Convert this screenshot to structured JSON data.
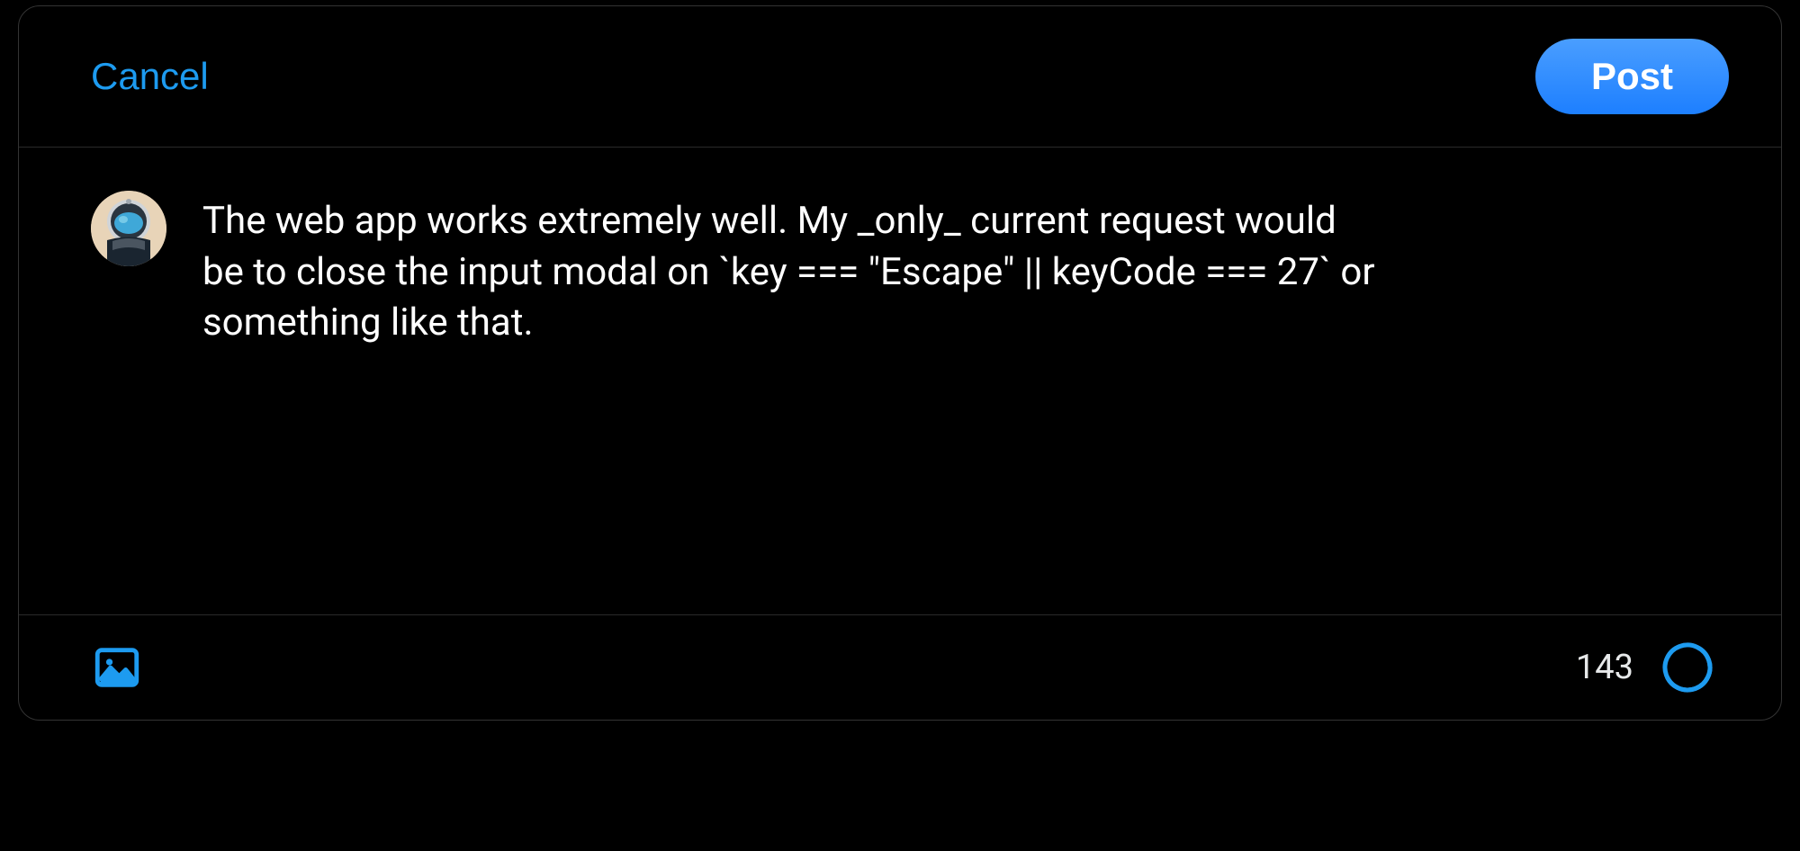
{
  "header": {
    "cancel_label": "Cancel",
    "post_label": "Post"
  },
  "compose": {
    "text": "The web app works extremely well. My _only_ current request would be to close the input modal on `key === \"Escape\" || keyCode === 27` or something like that."
  },
  "footer": {
    "char_remaining": "143",
    "progress": {
      "circumference": 157,
      "offset": 82
    }
  },
  "colors": {
    "accent": "#1d9bf0",
    "background": "#000000",
    "text": "#ffffff",
    "border": "#2a2a2a"
  }
}
